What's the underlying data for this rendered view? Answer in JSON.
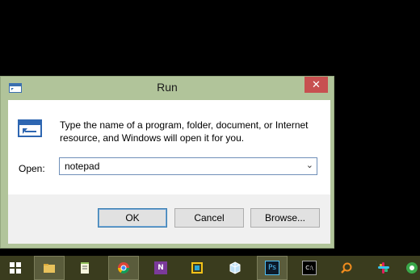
{
  "dialog": {
    "title": "Run",
    "close_glyph": "✕",
    "description": "Type the name of a program, folder, document, or Internet resource, and Windows will open it for you.",
    "open_label": "Open:",
    "open_value": "notepad",
    "buttons": {
      "ok": "OK",
      "cancel": "Cancel",
      "browse": "Browse..."
    }
  },
  "taskbar": {
    "items": [
      {
        "name": "start-button",
        "icon": "windows-logo"
      },
      {
        "name": "file-explorer",
        "icon": "folder-icon"
      },
      {
        "name": "notepad",
        "icon": "notepad-icon"
      },
      {
        "name": "chrome",
        "icon": "chrome-icon"
      },
      {
        "name": "onenote",
        "icon": "onenote-icon",
        "text": "N"
      },
      {
        "name": "app-square",
        "icon": "square-app-icon"
      },
      {
        "name": "virtualbox",
        "icon": "cube-icon"
      },
      {
        "name": "photoshop",
        "icon": "photoshop-icon",
        "text": "Ps"
      },
      {
        "name": "command-prompt",
        "icon": "cmd-icon",
        "text": "C:\\"
      },
      {
        "name": "search",
        "icon": "search-icon"
      },
      {
        "name": "slack",
        "icon": "slack-icon"
      },
      {
        "name": "app-green",
        "icon": "green-circle-icon"
      }
    ]
  },
  "colors": {
    "title_bar": "#b1c49a",
    "close": "#c75050",
    "taskbar": "#3a3c1e"
  }
}
